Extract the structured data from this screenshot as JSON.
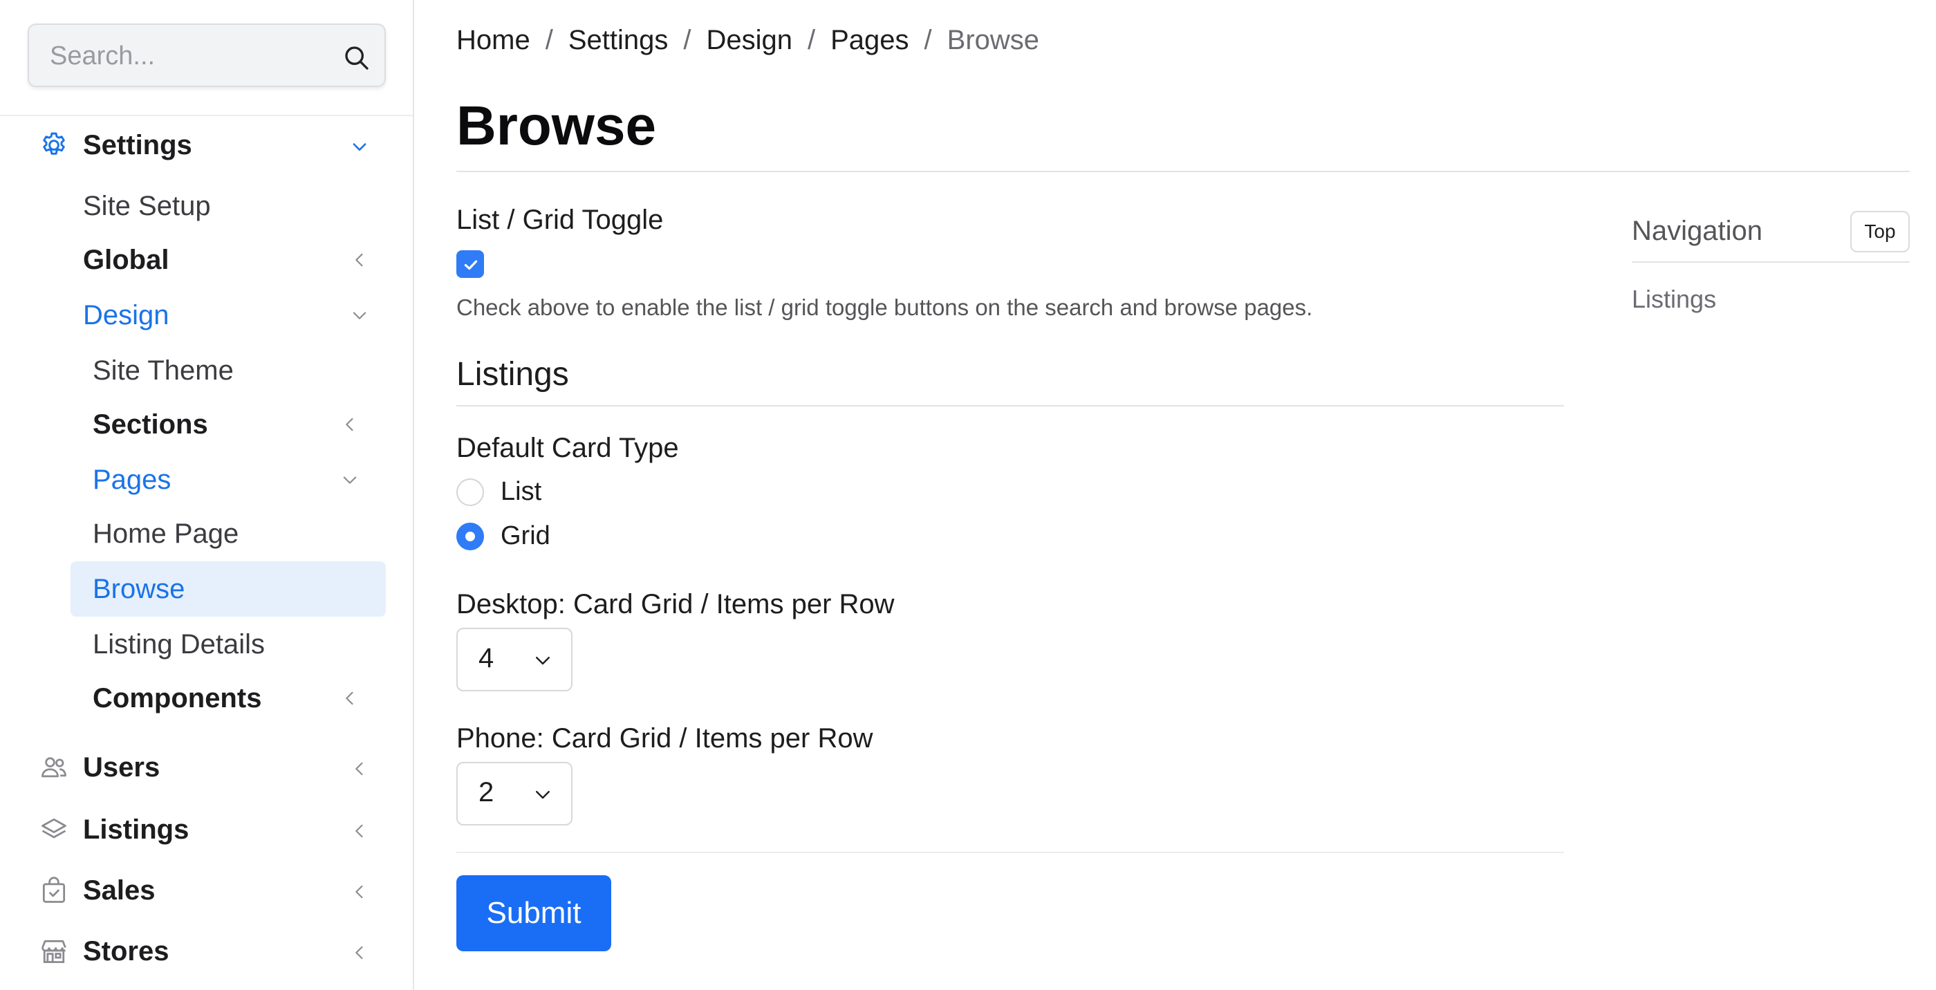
{
  "sidebar": {
    "search": {
      "placeholder": "Search..."
    },
    "items": [
      {
        "label": "Settings",
        "icon": "gear-icon"
      },
      {
        "label": "Site Setup"
      },
      {
        "label": "Global"
      },
      {
        "label": "Design"
      },
      {
        "label": "Site Theme"
      },
      {
        "label": "Sections"
      },
      {
        "label": "Pages"
      },
      {
        "label": "Home Page"
      },
      {
        "label": "Browse"
      },
      {
        "label": "Listing Details"
      },
      {
        "label": "Components"
      },
      {
        "label": "Users",
        "icon": "users-icon"
      },
      {
        "label": "Listings",
        "icon": "layers-icon"
      },
      {
        "label": "Sales",
        "icon": "shopping-bag-icon"
      },
      {
        "label": "Stores",
        "icon": "store-icon"
      }
    ]
  },
  "breadcrumb": [
    "Home",
    "Settings",
    "Design",
    "Pages",
    "Browse"
  ],
  "page": {
    "title": "Browse",
    "toggle_label": "List / Grid Toggle",
    "toggle_checked": true,
    "toggle_help": "Check above to enable the list / grid toggle buttons on the search and browse pages.",
    "section_title": "Listings",
    "card_type_label": "Default Card Type",
    "card_type_options": [
      "List",
      "Grid"
    ],
    "card_type_selected": "Grid",
    "desktop_label": "Desktop: Card Grid / Items per Row",
    "desktop_value": "4",
    "phone_label": "Phone: Card Grid / Items per Row",
    "phone_value": "2",
    "submit_label": "Submit"
  },
  "right_nav": {
    "title": "Navigation",
    "top_label": "Top",
    "links": [
      "Listings"
    ]
  },
  "colors": {
    "accent": "#1a6ef5",
    "active_bg": "#e6f0fc",
    "active_text": "#1a73e8"
  }
}
